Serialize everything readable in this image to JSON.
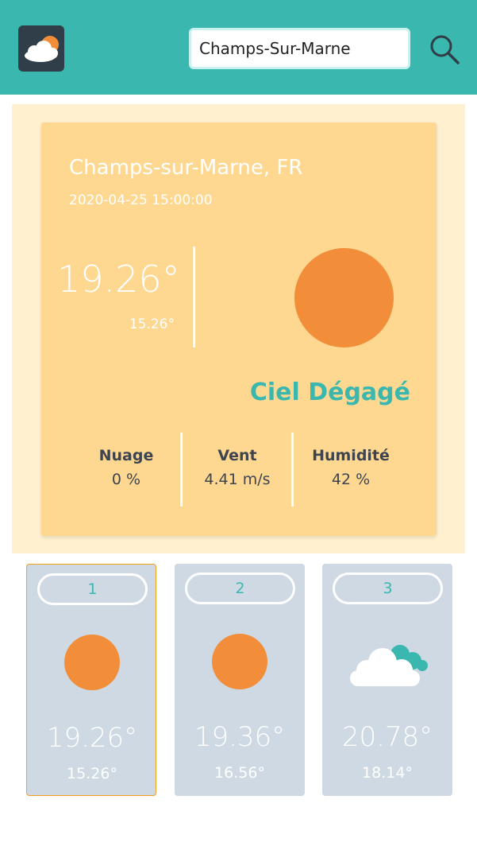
{
  "header": {
    "logo_icon": "sun-cloud-icon",
    "search_value": "Champs-Sur-Marne",
    "search_icon": "search-icon",
    "background_color": "#3ab7ae"
  },
  "current": {
    "city": "Champs-sur-Marne, FR",
    "datetime": "2020-04-25 15:00:00",
    "temp": "19.26°",
    "temp_min": "15.26°",
    "icon": "sun-icon",
    "description": "Ciel Dégagé",
    "stats": [
      {
        "label": "Nuage",
        "value": "0 %"
      },
      {
        "label": "Vent",
        "value": "4.41 m/s"
      },
      {
        "label": "Humidité",
        "value": "42 %"
      }
    ]
  },
  "forecast": [
    {
      "day": "1",
      "icon": "sun-icon",
      "temp": "19.26°",
      "temp_min": "15.26°",
      "selected": true
    },
    {
      "day": "2",
      "icon": "sun-icon",
      "temp": "19.36°",
      "temp_min": "16.56°",
      "selected": false
    },
    {
      "day": "3",
      "icon": "cloud-icon",
      "temp": "20.78°",
      "temp_min": "18.14°",
      "selected": false
    }
  ],
  "colors": {
    "accent": "#3ab7ae",
    "sun": "#f28e3a",
    "card": "#fed891",
    "card_bg": "#fff1cf",
    "forecast_card": "#cfd9e3",
    "selected_border": "#f2a021"
  }
}
